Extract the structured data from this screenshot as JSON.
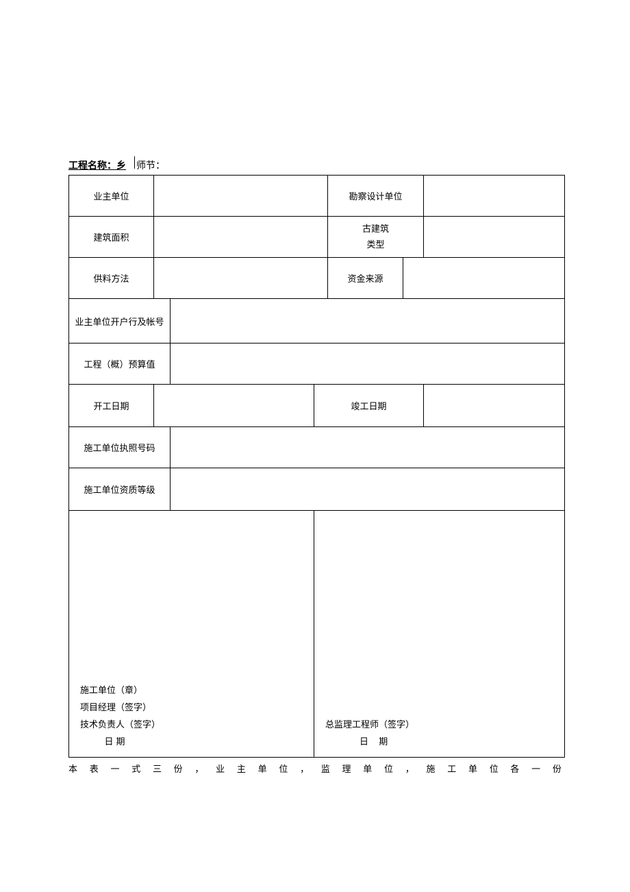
{
  "title": {
    "prefix": "工程名称：乡",
    "suffix": "师节："
  },
  "rows": {
    "r1": {
      "label1": "业主单位",
      "label2": "勘察设计单位"
    },
    "r2": {
      "label1": "建筑面积",
      "label2_line1": "古建筑",
      "label2_line2": "类型"
    },
    "r3": {
      "label1": "供料方法",
      "label2": "资金来源"
    },
    "r4": {
      "label": "业主单位开户行及帐号"
    },
    "r5": {
      "label": "工程（概）预算值"
    },
    "r6": {
      "label1": "开工日期",
      "label2": "竣工日期"
    },
    "r7": {
      "label": "施工单位执照号码"
    },
    "r8": {
      "label": "施工单位资质等级"
    }
  },
  "sig": {
    "left": {
      "line1": "施工单位（章）",
      "line2": "项目经理（签字）",
      "line3": "技术负责人（签字）",
      "line4": "日期"
    },
    "right": {
      "line1": "总监理工程师（签字）",
      "line2": "日    期"
    }
  },
  "footer": "本表一式三份，业主单位，监理单位，施工单位各一份"
}
